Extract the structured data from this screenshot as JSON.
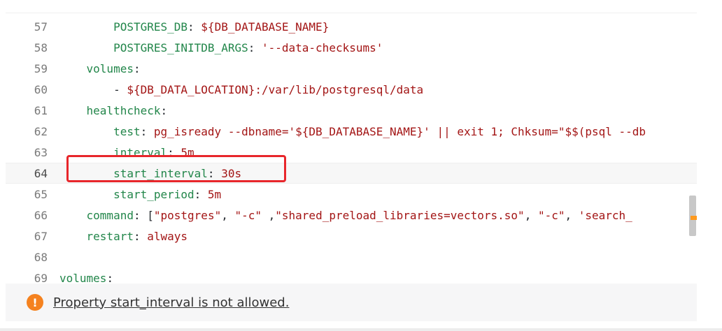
{
  "editor": {
    "lines": [
      {
        "num": "57",
        "indent": "    ",
        "tokens": [
          {
            "t": "k",
            "v": "POSTGRES_DB"
          },
          {
            "t": "p",
            "v": ": "
          },
          {
            "t": "s",
            "v": "${DB_DATABASE_NAME}"
          }
        ]
      },
      {
        "num": "58",
        "indent": "    ",
        "tokens": [
          {
            "t": "k",
            "v": "POSTGRES_INITDB_ARGS"
          },
          {
            "t": "p",
            "v": ": "
          },
          {
            "t": "s",
            "v": "'--data-checksums'"
          }
        ]
      },
      {
        "num": "59",
        "indent": "  ",
        "tokens": [
          {
            "t": "k",
            "v": "volumes"
          },
          {
            "t": "p",
            "v": ":"
          }
        ]
      },
      {
        "num": "60",
        "indent": "    ",
        "tokens": [
          {
            "t": "p",
            "v": "- "
          },
          {
            "t": "s",
            "v": "${DB_DATA_LOCATION}:/var/lib/postgresql/data"
          }
        ]
      },
      {
        "num": "61",
        "indent": "  ",
        "tokens": [
          {
            "t": "k",
            "v": "healthcheck"
          },
          {
            "t": "p",
            "v": ":"
          }
        ]
      },
      {
        "num": "62",
        "indent": "    ",
        "tokens": [
          {
            "t": "k",
            "v": "test"
          },
          {
            "t": "p",
            "v": ": "
          },
          {
            "t": "s",
            "v": "pg_isready --dbname='${DB_DATABASE_NAME}' || exit 1; Chksum=\"$$(psql --db"
          }
        ]
      },
      {
        "num": "63",
        "indent": "    ",
        "tokens": [
          {
            "t": "k",
            "v": "interval"
          },
          {
            "t": "p",
            "v": ": "
          },
          {
            "t": "s",
            "v": "5m"
          }
        ]
      },
      {
        "num": "64",
        "indent": "    ",
        "active": true,
        "tokens": [
          {
            "t": "k",
            "v": "start_interval"
          },
          {
            "t": "p",
            "v": ": "
          },
          {
            "t": "s",
            "v": "30s"
          }
        ]
      },
      {
        "num": "65",
        "indent": "    ",
        "tokens": [
          {
            "t": "k",
            "v": "start_period"
          },
          {
            "t": "p",
            "v": ": "
          },
          {
            "t": "s",
            "v": "5m"
          }
        ]
      },
      {
        "num": "66",
        "indent": "  ",
        "tokens": [
          {
            "t": "k",
            "v": "command"
          },
          {
            "t": "p",
            "v": ": ["
          },
          {
            "t": "s",
            "v": "\"postgres\""
          },
          {
            "t": "p",
            "v": ", "
          },
          {
            "t": "s",
            "v": "\"-c\""
          },
          {
            "t": "p",
            "v": " ,"
          },
          {
            "t": "s",
            "v": "\"shared_preload_libraries=vectors.so\""
          },
          {
            "t": "p",
            "v": ", "
          },
          {
            "t": "s",
            "v": "\"-c\""
          },
          {
            "t": "p",
            "v": ", "
          },
          {
            "t": "s",
            "v": "'search_"
          }
        ]
      },
      {
        "num": "67",
        "indent": "  ",
        "tokens": [
          {
            "t": "k",
            "v": "restart"
          },
          {
            "t": "p",
            "v": ": "
          },
          {
            "t": "s",
            "v": "always"
          }
        ]
      },
      {
        "num": "68",
        "indent": "",
        "tokens": []
      },
      {
        "num": "69",
        "indent": "",
        "tokens": [
          {
            "t": "k",
            "v": "volumes"
          },
          {
            "t": "p",
            "v": ":"
          }
        ]
      }
    ]
  },
  "problem": {
    "icon": "warning-icon",
    "icon_glyph": "!",
    "message": "Property start_interval is not allowed."
  },
  "colors": {
    "key": "#22864a",
    "string": "#a31515",
    "highlight_box": "#e8262b",
    "warning": "#f5821f"
  }
}
